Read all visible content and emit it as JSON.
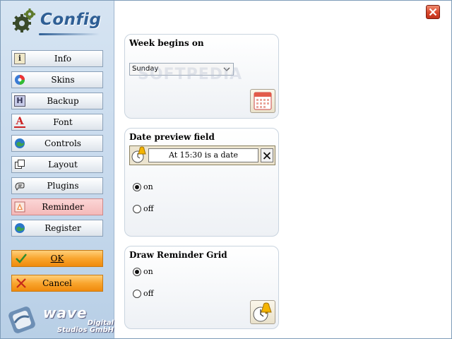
{
  "sidebar": {
    "title": "Config",
    "items": [
      {
        "label": "Info",
        "icon": "info-icon"
      },
      {
        "label": "Skins",
        "icon": "skins-icon"
      },
      {
        "label": "Backup",
        "icon": "backup-icon"
      },
      {
        "label": "Font",
        "icon": "font-icon"
      },
      {
        "label": "Controls",
        "icon": "controls-icon"
      },
      {
        "label": "Layout",
        "icon": "layout-icon"
      },
      {
        "label": "Plugins",
        "icon": "plugins-icon"
      },
      {
        "label": "Reminder",
        "icon": "reminder-icon",
        "active": true
      },
      {
        "label": "Register",
        "icon": "register-icon"
      }
    ],
    "ok_label": "OK",
    "cancel_label": "Cancel",
    "brand": {
      "name": "wave",
      "line1": "Digital",
      "line2": "Studios GmbH"
    }
  },
  "panels": {
    "week": {
      "title": "Week begins on",
      "selected": "Sunday",
      "watermark": "SOFTPEDIA"
    },
    "preview": {
      "title": "Date preview field",
      "value": "At 15:30 is a date",
      "option_on": "on",
      "option_off": "off",
      "selected": "on"
    },
    "grid": {
      "title": "Draw Reminder Grid",
      "option_on": "on",
      "option_off": "off",
      "selected": "on"
    }
  },
  "colors": {
    "accent_title": "#2f5f95",
    "action_button": "#f9a52e",
    "active_item": "#f4b9b9",
    "close_button": "#d8452a"
  }
}
